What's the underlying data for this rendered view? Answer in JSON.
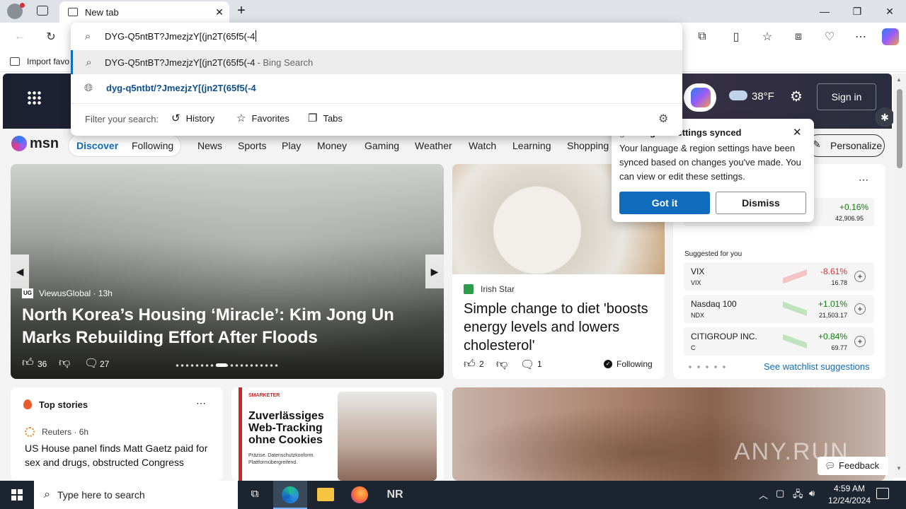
{
  "browser": {
    "tab_title": "New tab",
    "omnibox_value": "DYG-Q5ntBT?JmezjzY[(jn2T(65f5(-4",
    "suggestions": [
      {
        "text": "DYG-Q5ntBT?JmezjzY[(jn2T(65f5(-4",
        "suffix": " - Bing Search"
      },
      {
        "text": "dyg-q5ntbt/?JmezjzY[(jn2T(65f5(-4",
        "suffix": ""
      }
    ],
    "filter_label": "Filter your search:",
    "filters": [
      "History",
      "Favorites",
      "Tabs"
    ],
    "favbar_import": "Import favo"
  },
  "msn": {
    "weather_temp": "38°F",
    "sign_in": "Sign in",
    "logo_text": "msn",
    "nav": [
      "Discover",
      "Following",
      "News",
      "Sports",
      "Play",
      "Money",
      "Gaming",
      "Weather",
      "Watch",
      "Learning",
      "Shopping"
    ],
    "personalize": "Personalize",
    "hero": {
      "source": "ViewusGlobal",
      "age": "13h",
      "headline": "North Korea’s Housing ‘Miracle’: Kim Jong Un Marks Rebuilding Effort After Floods",
      "likes": "36",
      "comments": "27"
    },
    "article2": {
      "source": "Irish Star",
      "headline": "Simple change to diet 'boosts energy levels and lowers cholesterol'",
      "likes": "2",
      "comments": "1",
      "following": "Following"
    },
    "popup": {
      "title": "Language & region settings synced",
      "title_visible": "egion settings synced",
      "title_prefix": "g",
      "body": "Your language & region settings have been synced based on changes you've made. You can view or edit these settings.",
      "primary": "Got it",
      "secondary": "Dismiss"
    },
    "watchlist": {
      "top": {
        "change": "+0.16%",
        "value": "42,906.95"
      },
      "suggested_label": "Suggested for you",
      "stocks": [
        {
          "name": "VIX",
          "symbol": "VIX",
          "change": "-8.61%",
          "value": "16.78",
          "color": "#d13438"
        },
        {
          "name": "Nasdaq 100",
          "symbol": "NDX",
          "change": "+1.01%",
          "value": "21,503.17",
          "color": "#107c10"
        },
        {
          "name": "CITIGROUP INC.",
          "symbol": "C",
          "change": "+0.84%",
          "value": "69.77",
          "color": "#107c10"
        }
      ],
      "see_suggestions": "See watchlist suggestions"
    },
    "top_stories": {
      "label": "Top stories",
      "source": "Reuters",
      "age": "6h",
      "headline": "US House panel finds Matt Gaetz paid for sex and drugs, obstructed Congress"
    },
    "ad": {
      "brand": "SMARKETER",
      "headline": "Zuverlässiges Web-Tracking ohne Cookies",
      "sub": "Präzise. Datenschutzkonform. Plattformübergreifend."
    },
    "feedback": "Feedback",
    "watermark": "ANY.RUN"
  },
  "taskbar": {
    "search_placeholder": "Type here to search",
    "time": "4:59 AM",
    "date": "12/24/2024",
    "nr_label": "NR"
  },
  "colors": {
    "accent": "#0f6cbd",
    "positive": "#107c10",
    "negative": "#d13438"
  }
}
